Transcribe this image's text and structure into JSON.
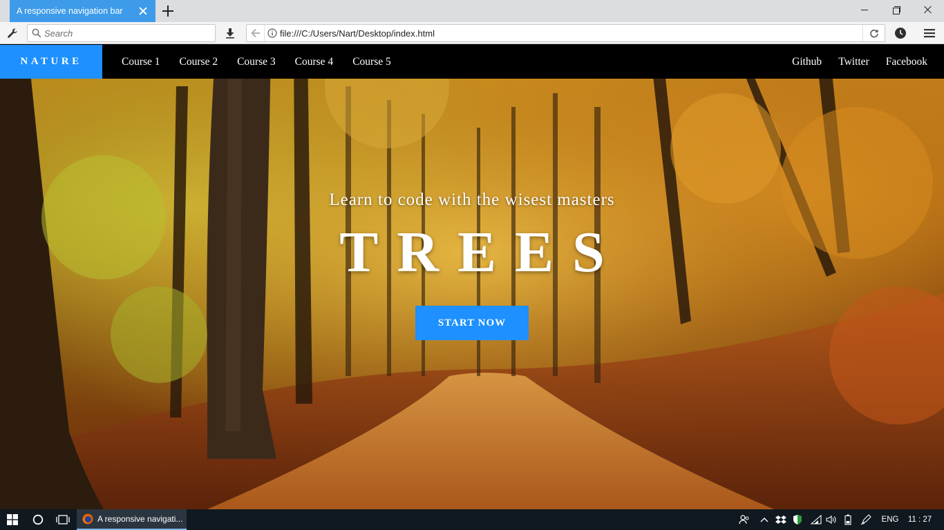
{
  "browser": {
    "tab_title": "A responsive navigation bar",
    "search_placeholder": "Search",
    "url": "file:///C:/Users/Nart/Desktop/index.html"
  },
  "navbar": {
    "brand": "NATURE",
    "left_links": [
      "Course 1",
      "Course 2",
      "Course 3",
      "Course 4",
      "Course 5"
    ],
    "right_links": [
      "Github",
      "Twitter",
      "Facebook"
    ]
  },
  "hero": {
    "subtitle": "Learn to code with the wisest masters",
    "title": "TREES",
    "cta_label": "START NOW"
  },
  "taskbar": {
    "app_label": "A responsive navigati...",
    "language": "ENG",
    "clock": "11 : 27"
  },
  "colors": {
    "accent": "#1e90ff",
    "tab_active": "#3d9be9",
    "navbar_bg": "#000000",
    "taskbar_bg": "#101820"
  },
  "icons": {
    "toolbar": [
      "wrench-icon",
      "search-icon",
      "download-icon",
      "back-arrow-icon",
      "info-icon",
      "reload-icon",
      "history-icon",
      "menu-icon"
    ],
    "taskbar": [
      "windows-start-icon",
      "cortana-icon",
      "task-view-icon",
      "firefox-icon",
      "people-icon",
      "chevron-up-icon",
      "dropbox-icon",
      "shield-icon",
      "wifi-icon",
      "volume-icon",
      "battery-icon",
      "pen-icon"
    ]
  }
}
